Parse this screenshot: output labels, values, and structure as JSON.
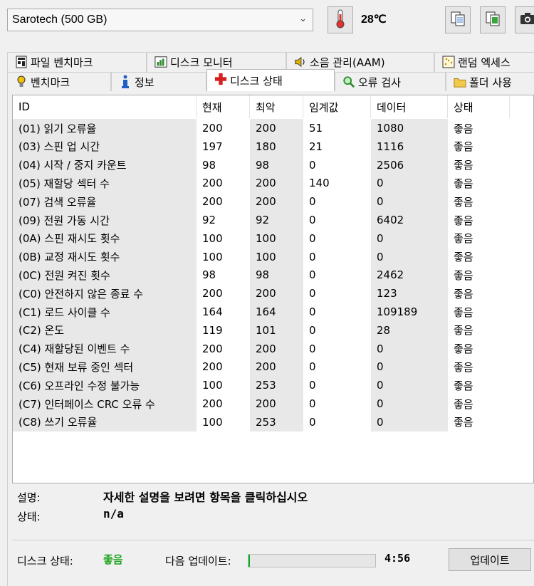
{
  "toolbar": {
    "drive": "Sarotech (500 GB)",
    "temperature": "28℃"
  },
  "tabs_top": [
    {
      "label": "파일 벤치마크",
      "icon": "file-benchmark-icon"
    },
    {
      "label": "디스크 모니터",
      "icon": "disk-monitor-icon"
    },
    {
      "label": "소음 관리(AAM)",
      "icon": "speaker-icon"
    },
    {
      "label": "랜덤 엑세스",
      "icon": "random-access-icon"
    }
  ],
  "tabs_bottom": [
    {
      "label": "벤치마크",
      "icon": "lightbulb-icon"
    },
    {
      "label": "정보",
      "icon": "info-icon"
    },
    {
      "label": "디스크 상태",
      "icon": "health-cross-icon",
      "active": true
    },
    {
      "label": "오류 검사",
      "icon": "magnifier-icon"
    },
    {
      "label": "폴더 사용",
      "icon": "folder-icon"
    }
  ],
  "table": {
    "headers": [
      "ID",
      "현재",
      "최악",
      "임계값",
      "데이터",
      "상태"
    ],
    "rows": [
      [
        "(01) 읽기 오류율",
        "200",
        "200",
        "51",
        "1080",
        "좋음"
      ],
      [
        "(03) 스핀 업 시간",
        "197",
        "180",
        "21",
        "1116",
        "좋음"
      ],
      [
        "(04) 시작 / 중지 카운트",
        "98",
        "98",
        "0",
        "2506",
        "좋음"
      ],
      [
        "(05) 재할당 섹터 수",
        "200",
        "200",
        "140",
        "0",
        "좋음"
      ],
      [
        "(07) 검색 오류율",
        "200",
        "200",
        "0",
        "0",
        "좋음"
      ],
      [
        "(09) 전원 가동 시간",
        "92",
        "92",
        "0",
        "6402",
        "좋음"
      ],
      [
        "(0A) 스핀 재시도 횟수",
        "100",
        "100",
        "0",
        "0",
        "좋음"
      ],
      [
        "(0B) 교정 재시도 횟수",
        "100",
        "100",
        "0",
        "0",
        "좋음"
      ],
      [
        "(0C) 전원 켜진 횟수",
        "98",
        "98",
        "0",
        "2462",
        "좋음"
      ],
      [
        "(C0) 안전하지 않은 종료 수",
        "200",
        "200",
        "0",
        "123",
        "좋음"
      ],
      [
        "(C1) 로드 사이클 수",
        "164",
        "164",
        "0",
        "109189",
        "좋음"
      ],
      [
        "(C2) 온도",
        "119",
        "101",
        "0",
        "28",
        "좋음"
      ],
      [
        "(C4) 재할당된 이벤트 수",
        "200",
        "200",
        "0",
        "0",
        "좋음"
      ],
      [
        "(C5) 현재 보류 중인 섹터",
        "200",
        "200",
        "0",
        "0",
        "좋음"
      ],
      [
        "(C6) 오프라인 수정 불가능",
        "100",
        "253",
        "0",
        "0",
        "좋음"
      ],
      [
        "(C7) 인터페이스 CRC 오류 수",
        "200",
        "200",
        "0",
        "0",
        "좋음"
      ],
      [
        "(C8) 쓰기 오류율",
        "100",
        "253",
        "0",
        "0",
        "좋음"
      ]
    ]
  },
  "details": {
    "desc_label": "설명:",
    "desc_value": "자세한 설명을 보려면 항목을 클릭하십시오",
    "state_label": "상태:",
    "state_value": "n/a"
  },
  "footer": {
    "disk_state_label": "디스크 상태:",
    "disk_state_value": "좋음",
    "next_update_label": "다음 업데이트:",
    "progress_fraction": 0.01,
    "time": "4:56",
    "update_button": "업데이트"
  },
  "colors": {
    "good": "#1aa31a",
    "progress": "#06b025",
    "shaded_cell": "#e8e8e8"
  }
}
